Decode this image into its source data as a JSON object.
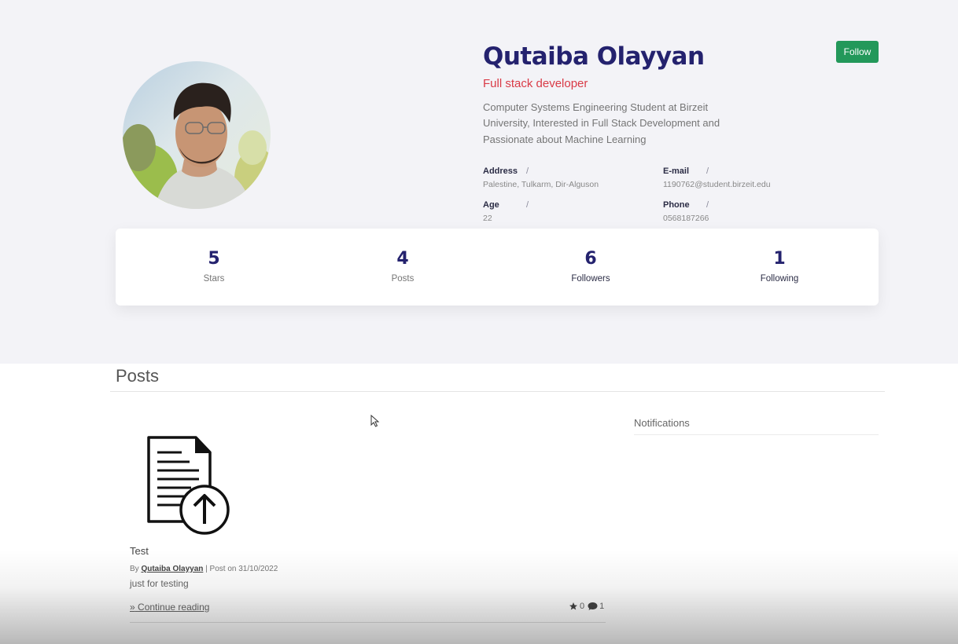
{
  "profile": {
    "name": "Qutaiba Olayyan",
    "role": "Full stack developer",
    "bio": "Computer Systems Engineering Student at Birzeit University, Interested in Full Stack Development and Passionate about Machine Learning",
    "follow_label": "Follow"
  },
  "info": {
    "address": {
      "label": "Address",
      "value": "Palestine, Tulkarm, Dir-Alguson"
    },
    "email": {
      "label": "E-mail",
      "value": "1190762@student.birzeit.edu"
    },
    "age": {
      "label": "Age",
      "value": "22"
    },
    "phone": {
      "label": "Phone",
      "value": "0568187266"
    },
    "separator": "/"
  },
  "stats": [
    {
      "value": "5",
      "label": "Stars"
    },
    {
      "value": "4",
      "label": "Posts"
    },
    {
      "value": "6",
      "label": "Followers"
    },
    {
      "value": "1",
      "label": "Following"
    }
  ],
  "posts_section": {
    "title": "Posts"
  },
  "post": {
    "title": "Test",
    "by_prefix": "By",
    "author": "Qutaiba Olayyan",
    "date_text": "| Post on 31/10/2022",
    "body": "just for testing",
    "continue_label": "Continue reading",
    "continue_prefix": "»",
    "stars": "0",
    "comments": "1",
    "icon": "document-upload-icon"
  },
  "notifications": {
    "title": "Notifications"
  },
  "colors": {
    "accent_navy": "#24226e",
    "role_red": "#d93a46",
    "follow_green": "#23985a",
    "hero_bg": "#f3f3f7"
  }
}
